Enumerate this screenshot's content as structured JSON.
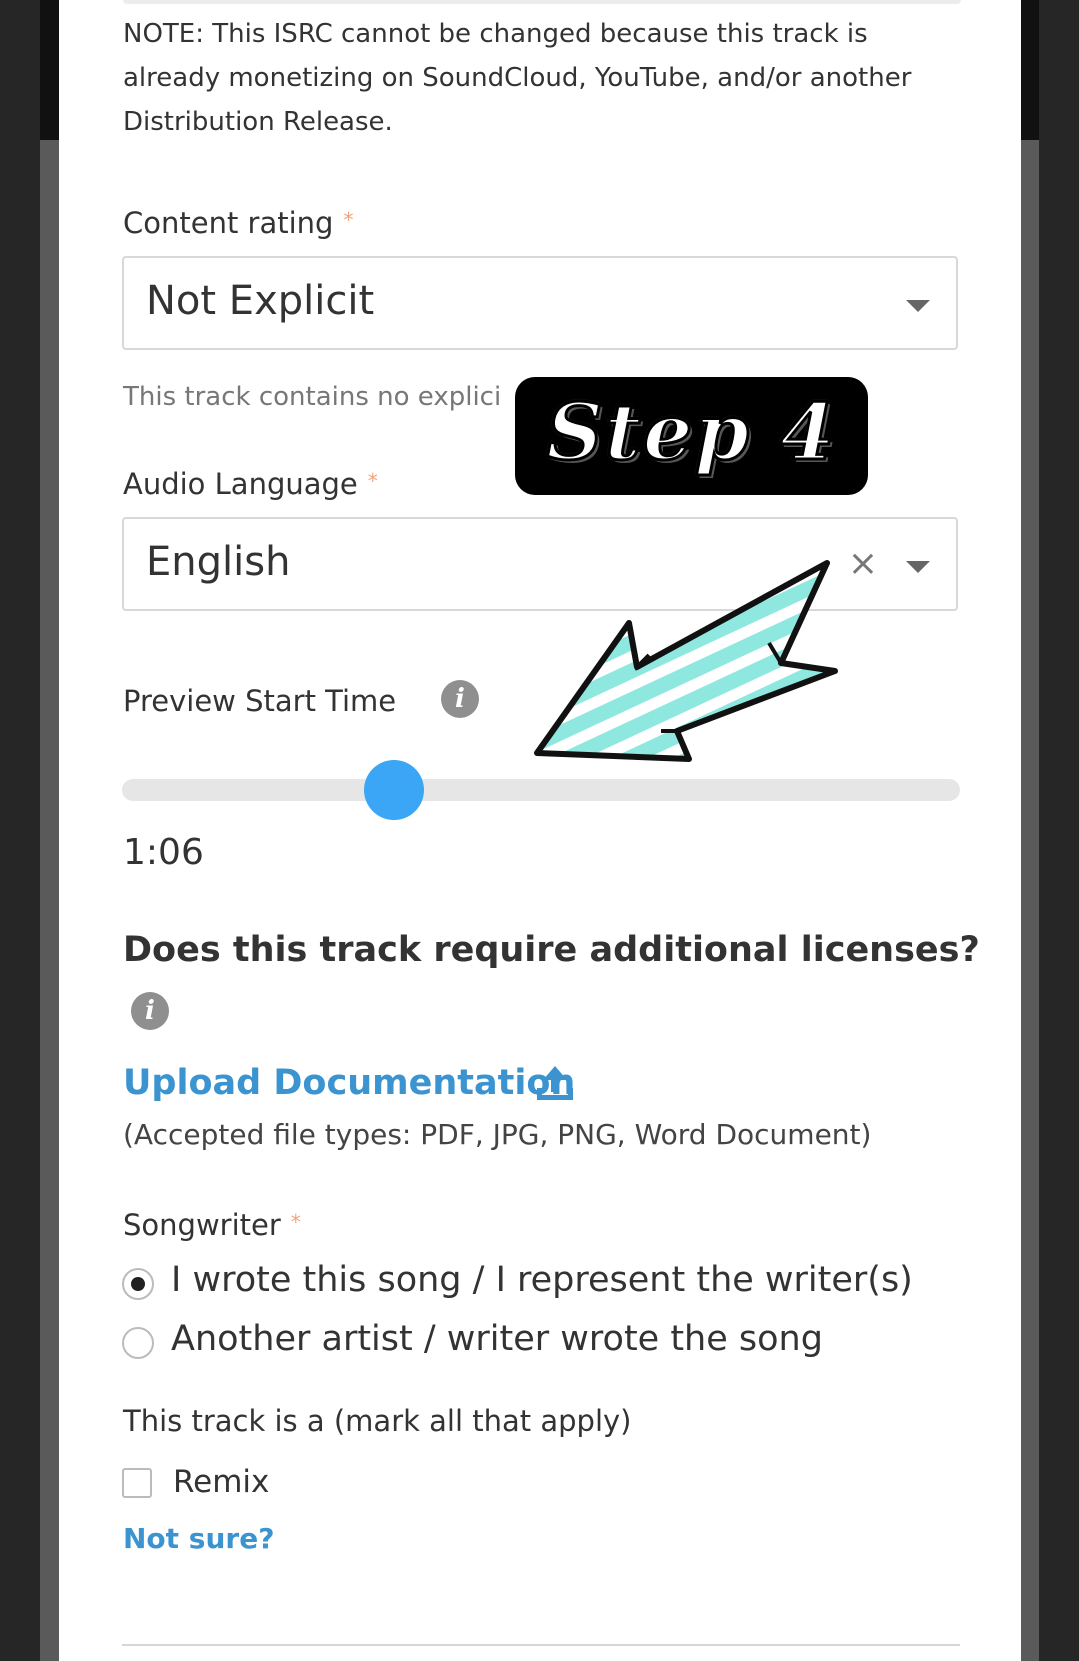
{
  "isrc_note": "NOTE: This ISRC cannot be changed because this track is already monetizing on SoundCloud, YouTube, and/or another Distribution Release.",
  "content_rating": {
    "label": "Content rating",
    "required_mark": "*",
    "value": "Not Explicit",
    "hint": "This track contains no explici"
  },
  "overlay": {
    "step_text": "Step 4",
    "arrow_colors": {
      "fill": "#8ee8e0",
      "stripe": "#ffffff",
      "outline": "#111111"
    }
  },
  "audio_language": {
    "label": "Audio Language",
    "required_mark": "*",
    "value": "English",
    "clear_glyph": "×"
  },
  "preview": {
    "label": "Preview Start Time",
    "time": "1:06",
    "slider_fraction": 0.325
  },
  "licenses": {
    "question": "Does this track require additional licenses?",
    "upload_label": "Upload Documentation",
    "accepted_types": "(Accepted file types: PDF, JPG, PNG, Word Document)"
  },
  "songwriter": {
    "label": "Songwriter",
    "required_mark": "*",
    "options": [
      {
        "label": "I wrote this song / I represent the writer(s)",
        "selected": true
      },
      {
        "label": "Another artist / writer wrote the song",
        "selected": false
      }
    ]
  },
  "track_type": {
    "label": "This track is a (mark all that apply)",
    "remix_label": "Remix",
    "remix_checked": false,
    "not_sure": "Not sure?"
  },
  "colors": {
    "accent_blue": "#3b93cf",
    "slider_thumb": "#3aa6f5",
    "required": "#f0a37a"
  }
}
